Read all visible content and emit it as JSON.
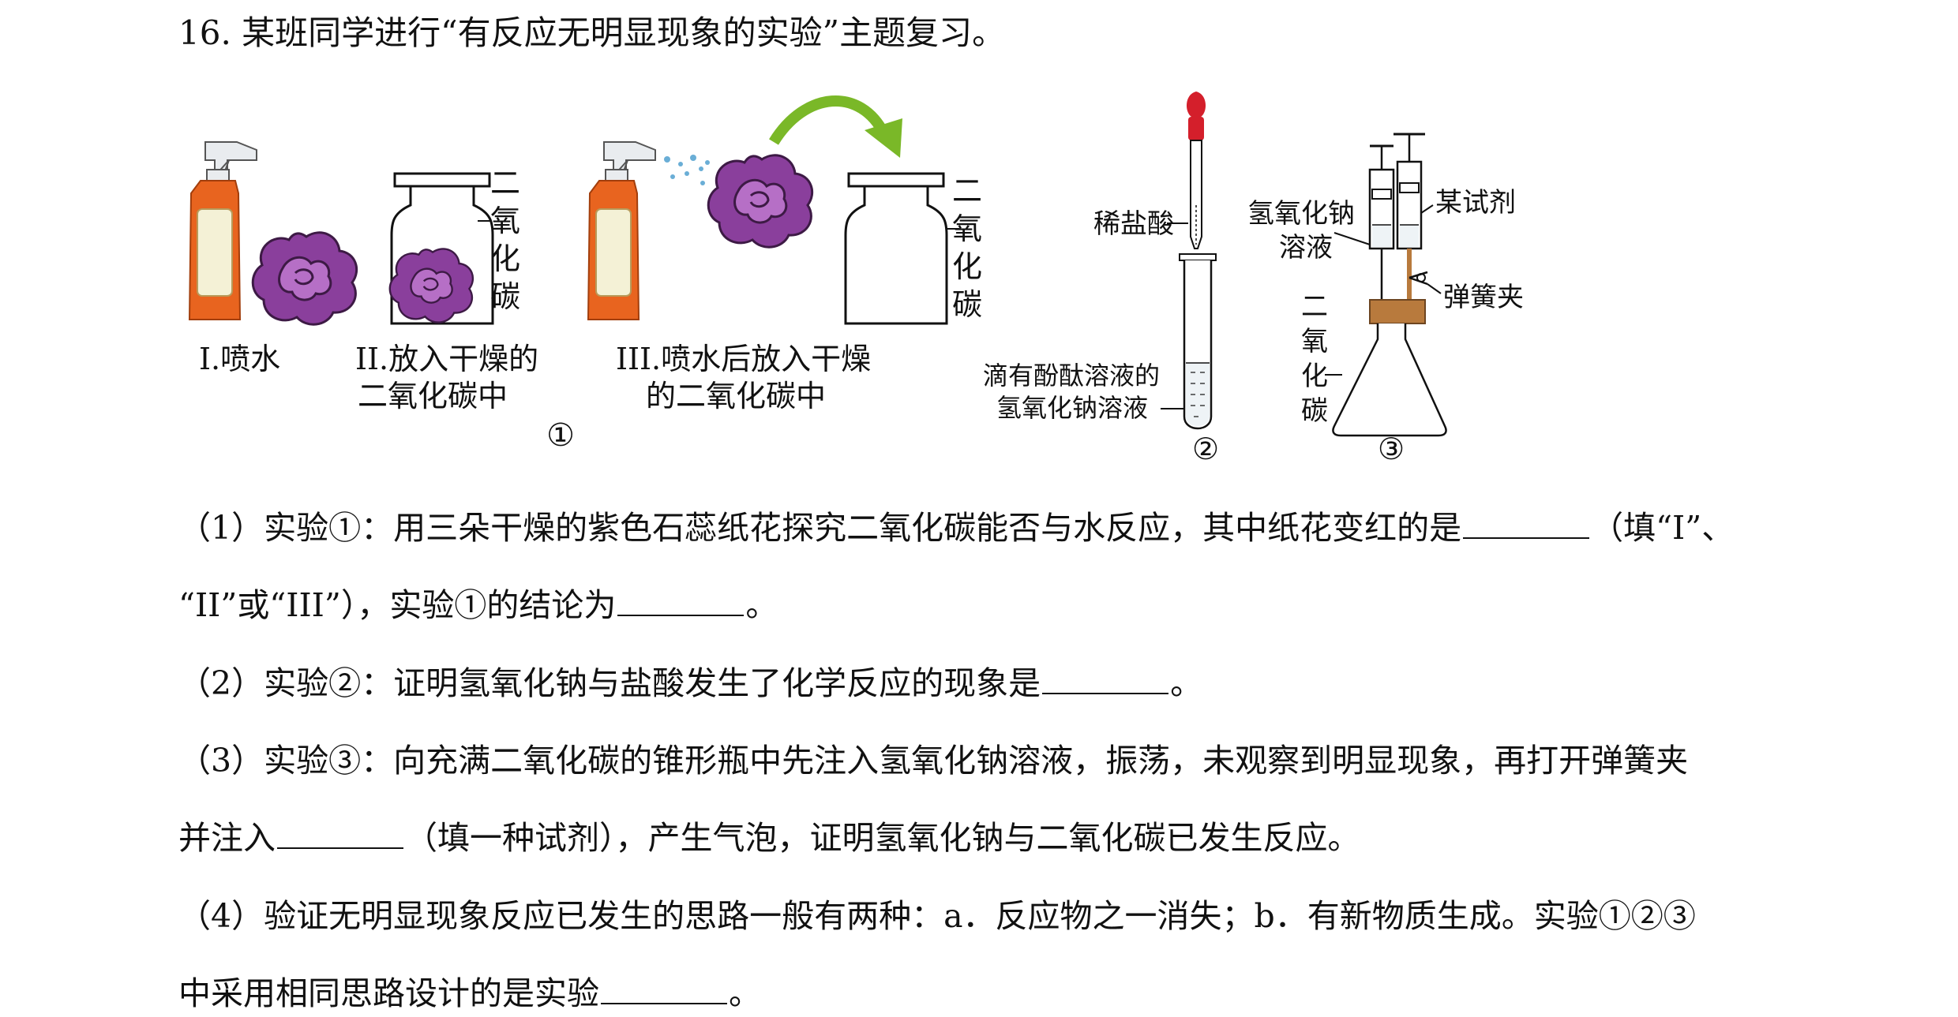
{
  "question": {
    "title": "16. 某班同学进行“有反应无明显现象的实验”主题复习。"
  },
  "figure": {
    "exp1": {
      "step1_label": "I.喷水",
      "step2_line1": "II.放入干燥的",
      "step2_line2": "二氧化碳中",
      "step3_line1": "III.喷水后放入干燥",
      "step3_line2": "的二氧化碳中",
      "jar_label_chars": [
        "二",
        "氧",
        "化",
        "碳"
      ],
      "number": "①"
    },
    "exp2": {
      "dropper_label": "稀盐酸",
      "tube_label_line1": "滴有酚酞溶液的",
      "tube_label_line2": "氢氧化钠溶液",
      "number": "②"
    },
    "exp3": {
      "naoh_label_line1": "氢氧化钠",
      "naoh_label_line2": "溶液",
      "reagent_label": "某试剂",
      "clip_label": "弹簧夹",
      "flask_label_chars": [
        "二",
        "氧",
        "化",
        "碳"
      ],
      "number": "③"
    },
    "colors": {
      "bottle_orange": "#e8641f",
      "flower_purple": "#8a3f9c",
      "arrow_green": "#7ab828",
      "bulb_red": "#d41f2b",
      "stopper_brown": "#b87a3d"
    }
  },
  "questions": {
    "q1_line1_a": "（1）实验①：用三朵干燥的紫色石蕊纸花探究二氧化碳能否与水反应，其中纸花变红的是",
    "q1_line1_b": "（填“I”、",
    "q1_line2_a": "“II”或“III”），实验①的结论为",
    "q1_line2_b": "。",
    "q2_a": "（2）实验②：证明氢氧化钠与盐酸发生了化学反应的现象是",
    "q2_b": "。",
    "q3_line1": "（3）实验③：向充满二氧化碳的锥形瓶中先注入氢氧化钠溶液，振荡，未观察到明显现象，再打开弹簧夹",
    "q3_line2_a": "并注入",
    "q3_line2_b": "（填一种试剂），产生气泡，证明氢氧化钠与二氧化碳已发生反应。",
    "q4_line1": "（4）验证无明显现象反应已发生的思路一般有两种：a．反应物之一消失；b．有新物质生成。实验①②③",
    "q4_line2_a": "中采用相同思路设计的是实验",
    "q4_line2_b": "。"
  }
}
